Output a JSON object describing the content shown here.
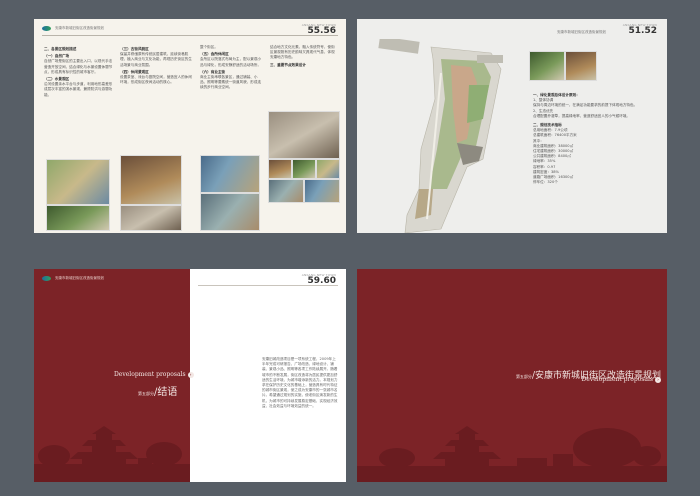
{
  "pages": [
    {
      "header": "安康市新城旧街区改造街景规划",
      "page_en": "ANKANG NEW TOWN",
      "page_numbers": "55.56",
      "col1": {
        "heading": "二、各景区规划描述",
        "sub1": "（一）自然广场",
        "text1": "自然广场是街区的主要出入口，以现代手法营造开放空间，结合绿化与水景设置休憩节点，形成具有标识性的城市客厅。",
        "sub2": "（二）水景观区",
        "text2": "沿河设置亲水平台与步道，利用地形高差形成层次丰富的滨水景观，兼顾防洪与游憩功能。"
      },
      "col2": {
        "sub1": "（三）古街风貌区",
        "text1": "保留并修缮原有传统民居建筑，延续街巷肌理，植入商业与文化功能，再现历史街区的生活场景与商业氛围。",
        "sub2": "（四）休闲景观区",
        "text2": "设置茶室、戏台与庭院空间，营造宜人的休闲环境，形成街区夜间活动的核心。"
      },
      "col3": {
        "text0": "整个街区。",
        "sub1": "（五）会所休闲区",
        "text1": "会所区以院落式布局为主，配以景观小品与绿化，形成安静舒适的活动场所。",
        "sub2": "（六）商业主街",
        "text2": "商业主街串联各景区，通过铺装、小品、照明等要素统一街道风貌，形成连续的步行商业空间。"
      },
      "col4": {
        "text1": "结合地方文化元素，融入传统符号，使街区景观既有历史韵味又具现代气息，体现安康地方特色。",
        "sub1": "三、重要节点效果设计"
      }
    },
    {
      "header": "安康市新城旧街区改造街景规划",
      "page_en": "ANKANG NEW TOWN",
      "page_numbers": "51.52",
      "sec1": "一、绿化景观总体设计原则：",
      "items": [
        "1、整体协调",
        "保持与周边环境的统一，在满足功能要求的前提下体现地方特色。",
        "2、生态优先",
        "合理配置乔灌草，提高绿地率，营造舒适宜人的小气候环境。"
      ],
      "sec2": "二、规划技术指标",
      "stats": [
        "总用地面积：7.9公顷",
        "总建筑面积：76400平方米",
        "其中：",
        "商业建筑面积：38000㎡",
        "住宅建筑面积：30000㎡",
        "公共建筑面积：8400㎡",
        "绿地率：35%",
        "容积率：0.97",
        "建筑密度：38%",
        "道路广场面积：16300㎡",
        "停车位：320个"
      ]
    },
    {
      "header": "安康市新城旧街区改造街景规划",
      "page_en": "ANKANG NEW TOWN",
      "page_numbers": "59.60",
      "dev": "Development proposals",
      "part": "第五部分",
      "title": "结语",
      "text": "安康旧城改造项目是一项系统工程，2009年上半年完成可研报告，广场改造、绿地设计、铺装、景观小品、照明等各项工作陆续展开。随着城市的不断发展，街区改造将为居民提供更加舒适的生活环境，为城市增添新的活力。本规划力求在保护历史文化的基础上，营造具有时代特征的城市街区景观，使之成为安康市的一张城市名片。希望通过规划的实施，使老街区焕发新的生机，为城市的可持续发展奠定基础，实现经济效益、社会效益与环境效益的统一。"
    },
    {
      "part": "第五部分",
      "title": "安康市新城旧街区改造街景规划",
      "dev": "Development proposals"
    }
  ]
}
